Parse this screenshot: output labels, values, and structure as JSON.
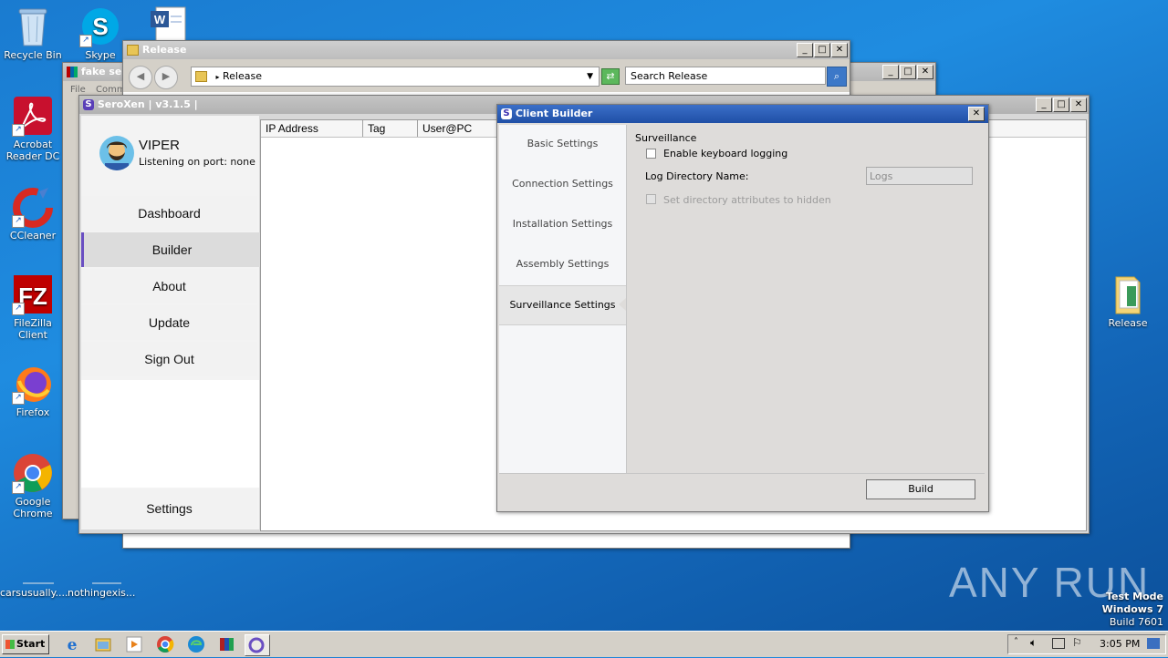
{
  "desktop": {
    "icons": [
      {
        "label": "Recycle Bin"
      },
      {
        "label": "Skype"
      },
      {
        "label": "Acrobat Reader DC"
      },
      {
        "label": "CCleaner"
      },
      {
        "label": "FileZilla Client"
      },
      {
        "label": "Firefox"
      },
      {
        "label": "Google Chrome"
      },
      {
        "label": "carsusually...."
      },
      {
        "label": "nothingexis..."
      },
      {
        "label": "Release"
      }
    ],
    "watermark": "ANY RUN",
    "test_mode": {
      "line1": "Test Mode",
      "line2": "Windows 7",
      "line3": "Build 7601"
    }
  },
  "explorer": {
    "title": "Release",
    "address": "Release",
    "search_placeholder": "Search Release"
  },
  "fake_window": {
    "title": "fake ser",
    "menu": [
      "File",
      "Comm"
    ]
  },
  "seroxen": {
    "title": "SeroXen | v3.1.5 |",
    "user": {
      "name": "VIPER",
      "status": "Listening on port: none"
    },
    "nav": [
      "Dashboard",
      "Builder",
      "About",
      "Update",
      "Sign Out"
    ],
    "settings": "Settings",
    "columns": [
      "IP Address",
      "Tag",
      "User@PC"
    ]
  },
  "client_builder": {
    "title": "Client Builder",
    "tabs": [
      "Basic Settings",
      "Connection Settings",
      "Installation Settings",
      "Assembly Settings",
      "Surveillance Settings"
    ],
    "section": "Surveillance",
    "keylog_label": "Enable keyboard logging",
    "logdir_label": "Log Directory Name:",
    "logdir_value": "Logs",
    "hidden_label": "Set directory attributes to hidden",
    "build": "Build"
  },
  "taskbar": {
    "start": "Start",
    "time": "3:05 PM"
  }
}
